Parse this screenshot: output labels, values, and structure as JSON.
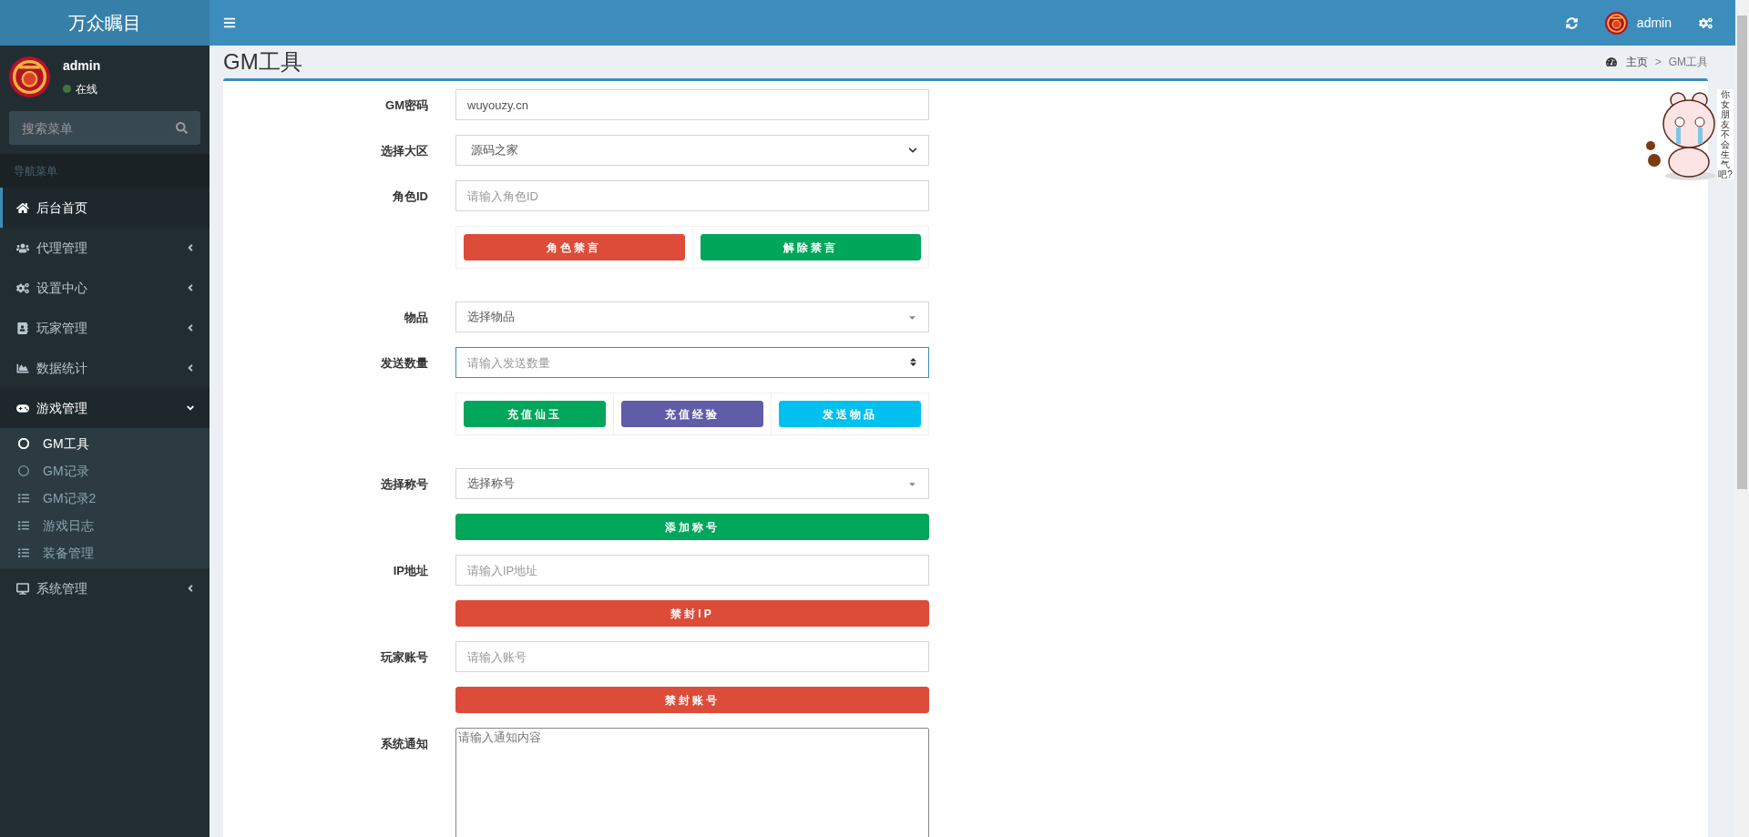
{
  "brand": "万众瞩目",
  "header": {
    "user": "admin"
  },
  "user_panel": {
    "name": "admin",
    "status": "在线",
    "online": true
  },
  "search": {
    "placeholder": "搜索菜单"
  },
  "nav_header": "导航菜单",
  "sidebar": {
    "items": [
      {
        "label": "后台首页",
        "selected": true
      },
      {
        "label": "代理管理",
        "selected": false,
        "expanded": false
      },
      {
        "label": "设置中心",
        "selected": false,
        "expanded": false
      },
      {
        "label": "玩家管理",
        "selected": false,
        "expanded": false
      },
      {
        "label": "数据统计",
        "selected": false,
        "expanded": false
      },
      {
        "label": "游戏管理",
        "selected": false,
        "expanded": true,
        "children": [
          {
            "label": "GM工具",
            "selected": true,
            "kind": "circle"
          },
          {
            "label": "GM记录",
            "selected": false,
            "kind": "circle"
          },
          {
            "label": "GM记录2",
            "selected": false,
            "kind": "list"
          },
          {
            "label": "游戏日志",
            "selected": false,
            "kind": "list"
          },
          {
            "label": "装备管理",
            "selected": false,
            "kind": "list"
          }
        ]
      },
      {
        "label": "系统管理",
        "selected": false,
        "expanded": false
      }
    ]
  },
  "page": {
    "title": "GM工具",
    "breadcrumb": [
      "主页",
      "GM工具"
    ],
    "separator": ">"
  },
  "form": [
    {
      "kind": "input",
      "label": "GM密码",
      "value": "wuyouzy.cn"
    },
    {
      "kind": "select",
      "label": "选择大区",
      "value": "源码之家"
    },
    {
      "kind": "input",
      "label": "角色ID",
      "placeholder": "请输入角色ID"
    },
    {
      "kind": "button_group",
      "buttons": [
        {
          "label": "角色禁言",
          "color": "#dd4b39"
        },
        {
          "label": "解除禁言",
          "color": "#00a65a"
        }
      ]
    },
    {
      "kind": "combo",
      "label": "物品",
      "value": "选择物品"
    },
    {
      "kind": "number",
      "label": "发送数量",
      "placeholder": "请输入发送数量",
      "focused": true
    },
    {
      "kind": "button_group",
      "buttons": [
        {
          "label": "充值仙玉",
          "color": "#00a65a"
        },
        {
          "label": "充值经验",
          "color": "#605ca8"
        },
        {
          "label": "发送物品",
          "color": "#00c0ef"
        }
      ]
    },
    {
      "kind": "combo",
      "label": "选择称号",
      "value": "选择称号"
    },
    {
      "kind": "button",
      "label": "添加称号",
      "color": "#00a65a"
    },
    {
      "kind": "input",
      "label": "IP地址",
      "placeholder": "请输入IP地址"
    },
    {
      "kind": "button",
      "label": "禁封IP",
      "color": "#dd4b39"
    },
    {
      "kind": "input",
      "label": "玩家账号",
      "placeholder": "请输入账号"
    },
    {
      "kind": "button",
      "label": "禁封账号",
      "color": "#dd4b39"
    },
    {
      "kind": "textarea",
      "label": "系统通知",
      "placeholder": "请输入通知内容"
    }
  ],
  "sticker": {
    "text": "你女朋友不会生气吧?"
  }
}
